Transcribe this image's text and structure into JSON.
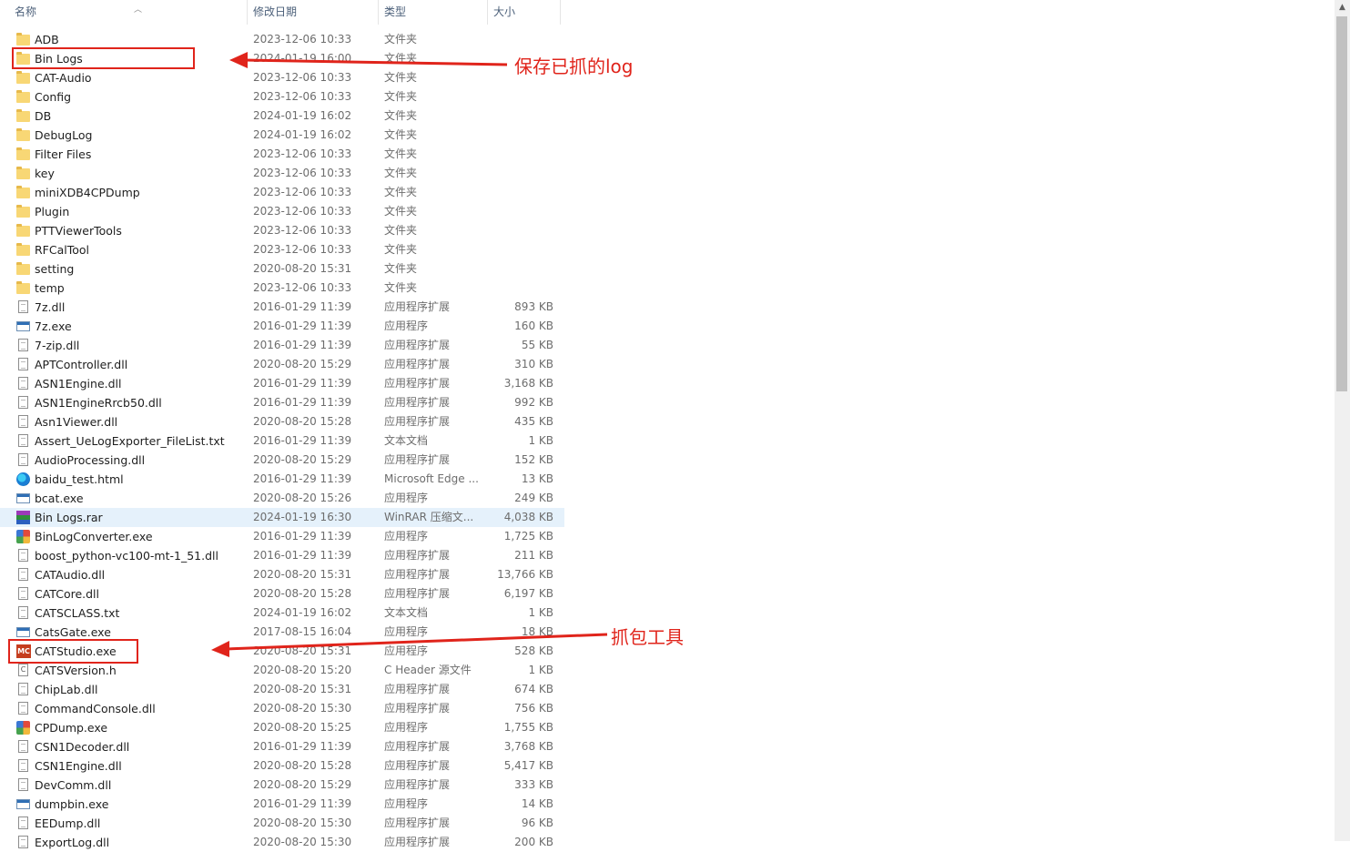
{
  "columns": {
    "name": "名称",
    "date": "修改日期",
    "type": "类型",
    "size": "大小"
  },
  "rows": [
    {
      "name": "ADB",
      "date": "2023-12-06 10:33",
      "type": "文件夹",
      "size": "",
      "icon": "folder-icon"
    },
    {
      "name": "Bin Logs",
      "date": "2024-01-19 16:00",
      "type": "文件夹",
      "size": "",
      "icon": "folder-icon"
    },
    {
      "name": "CAT-Audio",
      "date": "2023-12-06 10:33",
      "type": "文件夹",
      "size": "",
      "icon": "folder-icon"
    },
    {
      "name": "Config",
      "date": "2023-12-06 10:33",
      "type": "文件夹",
      "size": "",
      "icon": "folder-icon"
    },
    {
      "name": "DB",
      "date": "2024-01-19 16:02",
      "type": "文件夹",
      "size": "",
      "icon": "folder-icon"
    },
    {
      "name": "DebugLog",
      "date": "2024-01-19 16:02",
      "type": "文件夹",
      "size": "",
      "icon": "folder-icon"
    },
    {
      "name": "Filter Files",
      "date": "2023-12-06 10:33",
      "type": "文件夹",
      "size": "",
      "icon": "folder-icon"
    },
    {
      "name": "key",
      "date": "2023-12-06 10:33",
      "type": "文件夹",
      "size": "",
      "icon": "folder-icon"
    },
    {
      "name": "miniXDB4CPDump",
      "date": "2023-12-06 10:33",
      "type": "文件夹",
      "size": "",
      "icon": "folder-icon"
    },
    {
      "name": "Plugin",
      "date": "2023-12-06 10:33",
      "type": "文件夹",
      "size": "",
      "icon": "folder-icon"
    },
    {
      "name": "PTTViewerTools",
      "date": "2023-12-06 10:33",
      "type": "文件夹",
      "size": "",
      "icon": "folder-icon"
    },
    {
      "name": "RFCalTool",
      "date": "2023-12-06 10:33",
      "type": "文件夹",
      "size": "",
      "icon": "folder-icon"
    },
    {
      "name": "setting",
      "date": "2020-08-20 15:31",
      "type": "文件夹",
      "size": "",
      "icon": "folder-icon"
    },
    {
      "name": "temp",
      "date": "2023-12-06 10:33",
      "type": "文件夹",
      "size": "",
      "icon": "folder-icon"
    },
    {
      "name": "7z.dll",
      "date": "2016-01-29 11:39",
      "type": "应用程序扩展",
      "size": "893 KB",
      "icon": "dll-icon"
    },
    {
      "name": "7z.exe",
      "date": "2016-01-29 11:39",
      "type": "应用程序",
      "size": "160 KB",
      "icon": "exe-icon"
    },
    {
      "name": "7-zip.dll",
      "date": "2016-01-29 11:39",
      "type": "应用程序扩展",
      "size": "55 KB",
      "icon": "dll-icon"
    },
    {
      "name": "APTController.dll",
      "date": "2020-08-20 15:29",
      "type": "应用程序扩展",
      "size": "310 KB",
      "icon": "dll-icon"
    },
    {
      "name": "ASN1Engine.dll",
      "date": "2016-01-29 11:39",
      "type": "应用程序扩展",
      "size": "3,168 KB",
      "icon": "dll-icon"
    },
    {
      "name": "ASN1EngineRrcb50.dll",
      "date": "2016-01-29 11:39",
      "type": "应用程序扩展",
      "size": "992 KB",
      "icon": "dll-icon"
    },
    {
      "name": "Asn1Viewer.dll",
      "date": "2020-08-20 15:28",
      "type": "应用程序扩展",
      "size": "435 KB",
      "icon": "dll-icon"
    },
    {
      "name": "Assert_UeLogExporter_FileList.txt",
      "date": "2016-01-29 11:39",
      "type": "文本文档",
      "size": "1 KB",
      "icon": "text-file-icon"
    },
    {
      "name": "AudioProcessing.dll",
      "date": "2020-08-20 15:29",
      "type": "应用程序扩展",
      "size": "152 KB",
      "icon": "dll-icon"
    },
    {
      "name": "baidu_test.html",
      "date": "2016-01-29 11:39",
      "type": "Microsoft Edge ...",
      "size": "13 KB",
      "icon": "edge-icon"
    },
    {
      "name": "bcat.exe",
      "date": "2020-08-20 15:26",
      "type": "应用程序",
      "size": "249 KB",
      "icon": "exe-icon"
    },
    {
      "name": "Bin Logs.rar",
      "date": "2024-01-19 16:30",
      "type": "WinRAR 压缩文...",
      "size": "4,038 KB",
      "icon": "rar-icon",
      "selected": true
    },
    {
      "name": "BinLogConverter.exe",
      "date": "2016-01-29 11:39",
      "type": "应用程序",
      "size": "1,725 KB",
      "icon": "app-color-icon"
    },
    {
      "name": "boost_python-vc100-mt-1_51.dll",
      "date": "2016-01-29 11:39",
      "type": "应用程序扩展",
      "size": "211 KB",
      "icon": "dll-icon"
    },
    {
      "name": "CATAudio.dll",
      "date": "2020-08-20 15:31",
      "type": "应用程序扩展",
      "size": "13,766 KB",
      "icon": "dll-icon"
    },
    {
      "name": "CATCore.dll",
      "date": "2020-08-20 15:28",
      "type": "应用程序扩展",
      "size": "6,197 KB",
      "icon": "dll-icon"
    },
    {
      "name": "CATSCLASS.txt",
      "date": "2024-01-19 16:02",
      "type": "文本文档",
      "size": "1 KB",
      "icon": "text-file-icon"
    },
    {
      "name": "CatsGate.exe",
      "date": "2017-08-15 16:04",
      "type": "应用程序",
      "size": "18 KB",
      "icon": "exe-icon"
    },
    {
      "name": "CATStudio.exe",
      "date": "2020-08-20 15:31",
      "type": "应用程序",
      "size": "528 KB",
      "icon": "mc-app-icon"
    },
    {
      "name": "CATSVersion.h",
      "date": "2020-08-20 15:20",
      "type": "C Header 源文件",
      "size": "1 KB",
      "icon": "header-file-icon"
    },
    {
      "name": "ChipLab.dll",
      "date": "2020-08-20 15:31",
      "type": "应用程序扩展",
      "size": "674 KB",
      "icon": "dll-icon"
    },
    {
      "name": "CommandConsole.dll",
      "date": "2020-08-20 15:30",
      "type": "应用程序扩展",
      "size": "756 KB",
      "icon": "dll-icon"
    },
    {
      "name": "CPDump.exe",
      "date": "2020-08-20 15:25",
      "type": "应用程序",
      "size": "1,755 KB",
      "icon": "app-color-icon"
    },
    {
      "name": "CSN1Decoder.dll",
      "date": "2016-01-29 11:39",
      "type": "应用程序扩展",
      "size": "3,768 KB",
      "icon": "dll-icon"
    },
    {
      "name": "CSN1Engine.dll",
      "date": "2020-08-20 15:28",
      "type": "应用程序扩展",
      "size": "5,417 KB",
      "icon": "dll-icon"
    },
    {
      "name": "DevComm.dll",
      "date": "2020-08-20 15:29",
      "type": "应用程序扩展",
      "size": "333 KB",
      "icon": "dll-icon"
    },
    {
      "name": "dumpbin.exe",
      "date": "2016-01-29 11:39",
      "type": "应用程序",
      "size": "14 KB",
      "icon": "exe-icon"
    },
    {
      "name": "EEDump.dll",
      "date": "2020-08-20 15:30",
      "type": "应用程序扩展",
      "size": "96 KB",
      "icon": "dll-icon"
    },
    {
      "name": "ExportLog.dll",
      "date": "2020-08-20 15:30",
      "type": "应用程序扩展",
      "size": "200 KB",
      "icon": "dll-icon"
    }
  ],
  "annotations": {
    "saved_logs": "保存已抓的log",
    "capture_tool": "抓包工具",
    "color": "#e0241b"
  }
}
